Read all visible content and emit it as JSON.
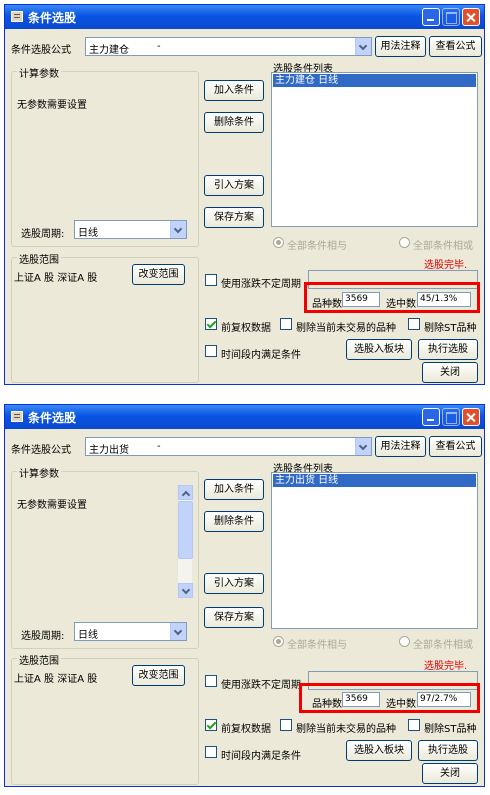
{
  "dialogs": [
    {
      "title": "条件选股",
      "formula_label": "条件选股公式",
      "formula_name": "主力建仓",
      "formula_desc": "-",
      "usage_button": "用法注释",
      "view_formula_button": "查看公式",
      "params_group": "计算参数",
      "no_params_text": "无参数需要设置",
      "condition_list_label": "选股条件列表",
      "condition_items": [
        "主力建仓  日线"
      ],
      "add_condition": "加入条件",
      "delete_condition": "删除条件",
      "import_plan": "引入方案",
      "save_plan": "保存方案",
      "period_label": "选股周期:",
      "period_value": "日线",
      "radio_all_and": "全部条件相与",
      "radio_all_or": "全部条件相或",
      "status_text": "选股完毕.",
      "scope_group": "选股范围",
      "scope_value": "上证A 股  深证A 股",
      "change_scope": "改变范围",
      "use_range_label": "使用涨跌不定周期",
      "count_label": "品种数",
      "count_value": "3569",
      "selected_label": "选中数",
      "selected_value": "45/1.3%",
      "forward_adjust_label": "前复权数据",
      "forward_adjust_checked": true,
      "exclude_untraded_label": "剔除当前未交易的品种",
      "exclude_st_label": "剔除ST品种",
      "time_range_label": "时间段内满足条件",
      "to_block_button": "选股入板块",
      "execute_button": "执行选股",
      "close_button": "关闭",
      "params_has_scrollbar": false
    },
    {
      "title": "条件选股",
      "formula_label": "条件选股公式",
      "formula_name": "主力出货",
      "formula_desc": "-",
      "usage_button": "用法注释",
      "view_formula_button": "查看公式",
      "params_group": "计算参数",
      "no_params_text": "无参数需要设置",
      "condition_list_label": "选股条件列表",
      "condition_items": [
        "主力出货  日线"
      ],
      "add_condition": "加入条件",
      "delete_condition": "删除条件",
      "import_plan": "引入方案",
      "save_plan": "保存方案",
      "period_label": "选股周期:",
      "period_value": "日线",
      "radio_all_and": "全部条件相与",
      "radio_all_or": "全部条件相或",
      "status_text": "选股完毕.",
      "scope_group": "选股范围",
      "scope_value": "上证A 股  深证A 股",
      "change_scope": "改变范围",
      "use_range_label": "使用涨跌不定周期",
      "count_label": "品种数",
      "count_value": "3569",
      "selected_label": "选中数",
      "selected_value": "97/2.7%",
      "forward_adjust_label": "前复权数据",
      "forward_adjust_checked": true,
      "exclude_untraded_label": "剔除当前未交易的品种",
      "exclude_st_label": "剔除ST品种",
      "time_range_label": "时间段内满足条件",
      "to_block_button": "选股入板块",
      "execute_button": "执行选股",
      "close_button": "关闭",
      "params_has_scrollbar": true
    }
  ],
  "colors": {
    "title_bar": "#0a55e3",
    "dialog_bg": "#ece9d8",
    "selection": "#316ac5",
    "status_red": "#e00000",
    "highlight_box": "#f20000"
  }
}
